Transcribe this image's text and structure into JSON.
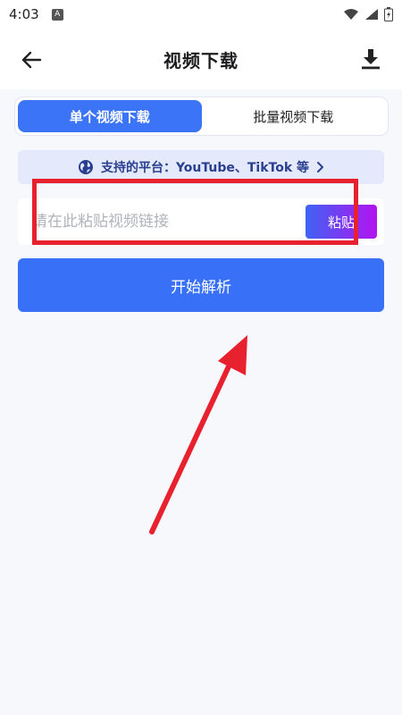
{
  "status_bar": {
    "time": "4:03",
    "notif_badge": "A"
  },
  "header": {
    "title": "视频下载"
  },
  "tabs": [
    {
      "label": "单个视频下载",
      "active": true
    },
    {
      "label": "批量视频下载",
      "active": false
    }
  ],
  "banner": {
    "text": "支持的平台：YouTube、TikTok 等"
  },
  "input": {
    "placeholder": "请在此粘贴视频链接",
    "value": ""
  },
  "paste_button": {
    "label": "粘贴"
  },
  "start_button": {
    "label": "开始解析"
  },
  "colors": {
    "accent": "#3b74f6",
    "paste_gradient_start": "#3f63f3",
    "paste_gradient_end": "#b313f0",
    "annotation": "#e8212e",
    "banner_bg": "#e4e9fb"
  }
}
